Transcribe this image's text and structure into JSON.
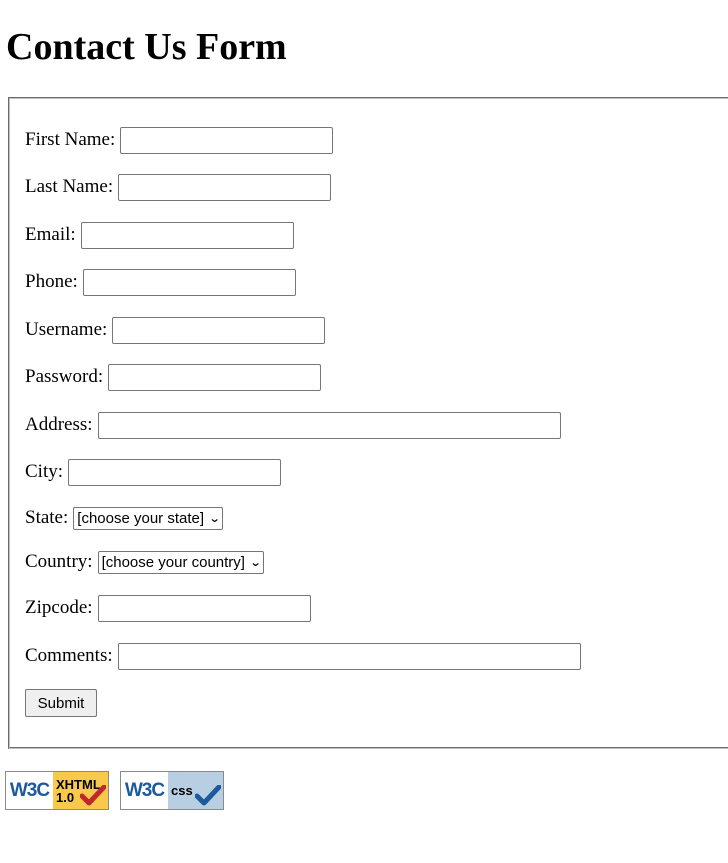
{
  "page": {
    "title": "Contact Us Form"
  },
  "form": {
    "fields": [
      {
        "label": "First Name:",
        "type": "text",
        "value": ""
      },
      {
        "label": "Last Name:",
        "type": "text",
        "value": ""
      },
      {
        "label": "Email:",
        "type": "text",
        "value": ""
      },
      {
        "label": "Phone:",
        "type": "text",
        "value": ""
      },
      {
        "label": "Username:",
        "type": "text",
        "value": ""
      },
      {
        "label": "Password:",
        "type": "password",
        "value": ""
      },
      {
        "label": "Address:",
        "type": "text",
        "value": ""
      },
      {
        "label": "City:",
        "type": "text",
        "value": ""
      },
      {
        "label": "State:",
        "type": "select",
        "selected": "[choose your state]"
      },
      {
        "label": "Country:",
        "type": "select",
        "selected": "[choose your country]"
      },
      {
        "label": "Zipcode:",
        "type": "text",
        "value": ""
      },
      {
        "label": "Comments:",
        "type": "text",
        "value": ""
      }
    ],
    "submit_label": "Submit"
  },
  "badges": [
    {
      "org": "W3C",
      "kind_line1": "XHTML",
      "kind_line2": "1.0",
      "check_color": "#c0282d",
      "icon": "check-icon"
    },
    {
      "org": "W3C",
      "kind_line1": "css",
      "kind_line2": "",
      "check_color": "#1d5a9c",
      "icon": "check-icon"
    }
  ]
}
